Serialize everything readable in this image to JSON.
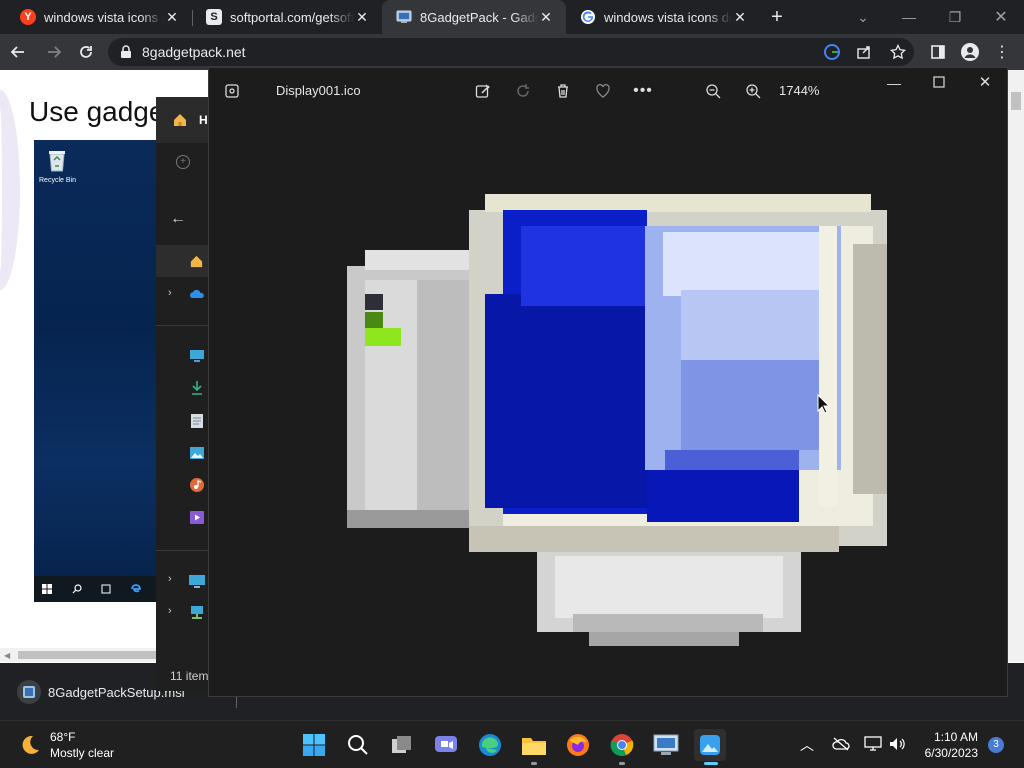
{
  "tabs": [
    {
      "title": "windows vista icons pa",
      "favicon": "yandex-icon"
    },
    {
      "title": "softportal.com/getsoft",
      "favicon": "softportal-icon"
    },
    {
      "title": "8GadgetPack - Gadget",
      "favicon": "gadget-icon"
    },
    {
      "title": "windows vista icons do",
      "favicon": "google-icon"
    }
  ],
  "address": {
    "url": "8gadgetpack.net"
  },
  "webpage": {
    "heading": "Use gadge",
    "desktop_shot": {
      "recycle_bin_label": "Recycle Bin"
    },
    "explorer": {
      "home_label": "H",
      "items_count": "11 item"
    }
  },
  "download": {
    "filename": "8GadgetPackSetup.msi"
  },
  "viewer": {
    "filename": "Display001.ico",
    "zoom": "1744%"
  },
  "taskbar": {
    "weather": {
      "temp": "68°F",
      "condition": "Mostly clear"
    },
    "clock": {
      "time": "1:10 AM",
      "date": "6/30/2023"
    },
    "notification_count": "3"
  },
  "colors": {
    "accent": "#60cdff",
    "chrome_dark": "#202124",
    "chrome_toolbar": "#35363a"
  }
}
